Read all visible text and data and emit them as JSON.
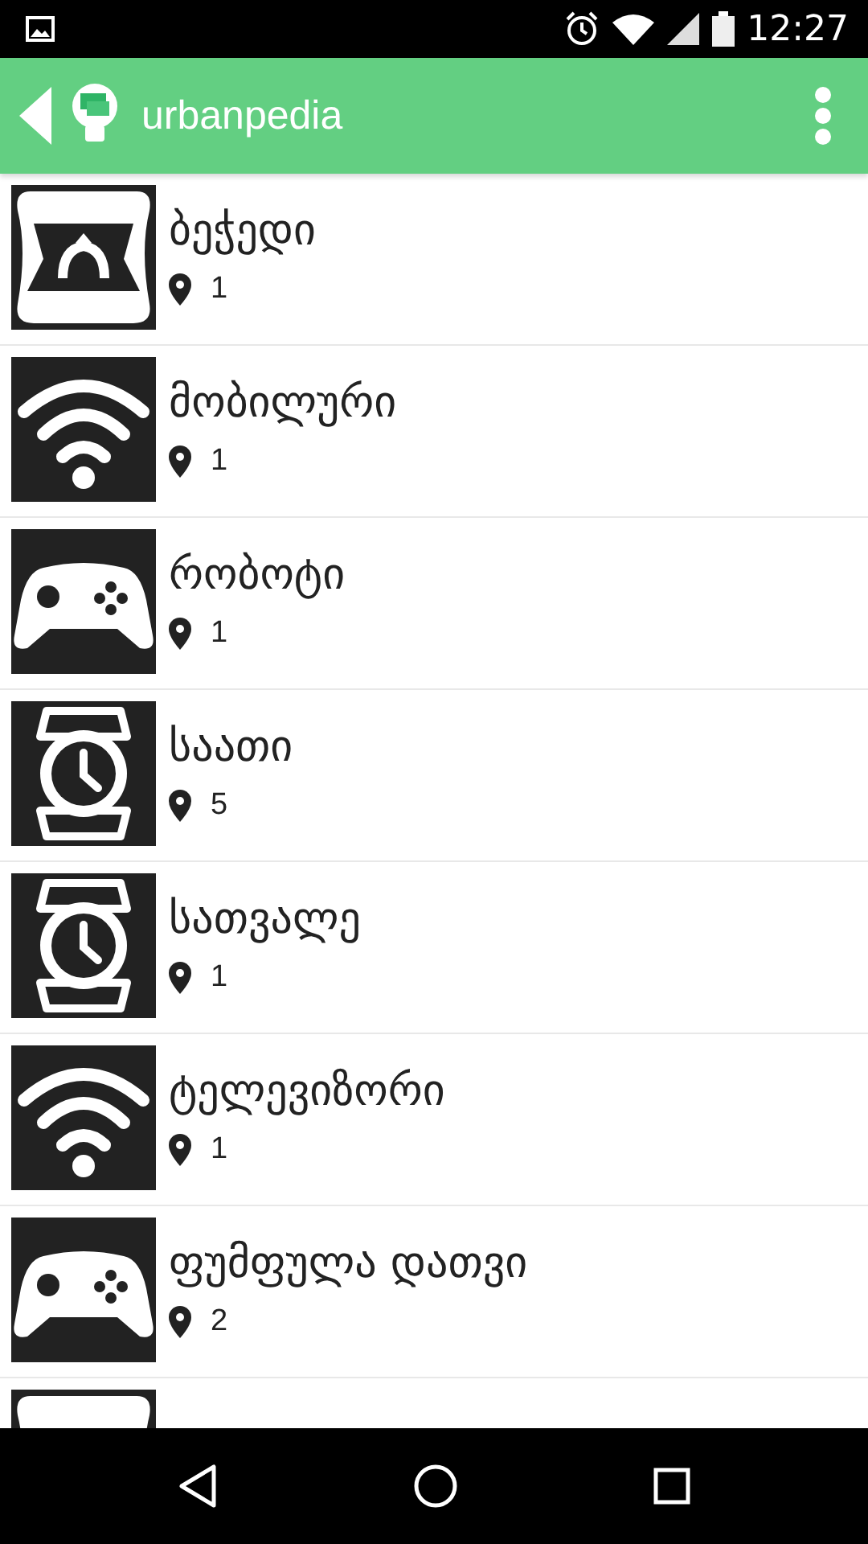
{
  "status_bar": {
    "time": "12:27"
  },
  "app_bar": {
    "title": "urbanpedia"
  },
  "items": [
    {
      "kind": "ring",
      "title": "ბეჭედი",
      "count": "1"
    },
    {
      "kind": "wifi",
      "title": "მობილური",
      "count": "1"
    },
    {
      "kind": "gamepad",
      "title": "რობოტი",
      "count": "1"
    },
    {
      "kind": "watch",
      "title": "საათი",
      "count": "5"
    },
    {
      "kind": "watch",
      "title": "სათვალე",
      "count": "1"
    },
    {
      "kind": "wifi",
      "title": "ტელევიზორი",
      "count": "1"
    },
    {
      "kind": "gamepad",
      "title": "ფუმფულა დათვი",
      "count": "2"
    },
    {
      "kind": "ring"
    }
  ]
}
